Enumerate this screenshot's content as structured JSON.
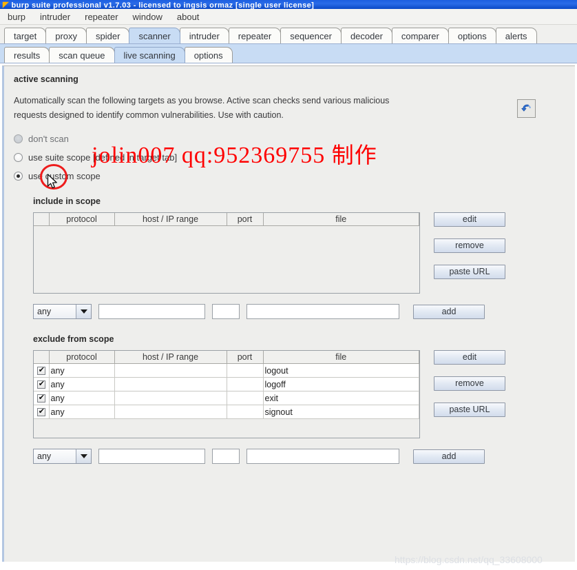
{
  "window": {
    "title": "burp suite professional v1.7.03 - licensed to ingsis ormaz [single user license]",
    "icon": "burp-logo-icon"
  },
  "menubar": {
    "items": [
      {
        "label": "burp"
      },
      {
        "label": "intruder"
      },
      {
        "label": "repeater"
      },
      {
        "label": "window"
      },
      {
        "label": "about"
      }
    ]
  },
  "main_tabs": {
    "items": [
      {
        "label": "target",
        "active": false
      },
      {
        "label": "proxy",
        "active": false
      },
      {
        "label": "spider",
        "active": false
      },
      {
        "label": "scanner",
        "active": true
      },
      {
        "label": "intruder",
        "active": false
      },
      {
        "label": "repeater",
        "active": false
      },
      {
        "label": "sequencer",
        "active": false
      },
      {
        "label": "decoder",
        "active": false
      },
      {
        "label": "comparer",
        "active": false
      },
      {
        "label": "options",
        "active": false
      },
      {
        "label": "alerts",
        "active": false
      }
    ]
  },
  "sub_tabs": {
    "items": [
      {
        "label": "results",
        "active": false
      },
      {
        "label": "scan queue",
        "active": false
      },
      {
        "label": "live scanning",
        "active": true
      },
      {
        "label": "options",
        "active": false
      }
    ]
  },
  "panel": {
    "heading": "active scanning",
    "description": "Automatically scan the following targets as you browse. Active scan checks send various malicious requests designed to identify common vulnerabilities. Use with caution.",
    "restore_icon": "undo-restore-icon"
  },
  "scan_mode": {
    "options": [
      {
        "label": "don't scan",
        "selected": false,
        "disabled": true
      },
      {
        "label": "use suite scope [defined in target tab]",
        "selected": false,
        "disabled": false
      },
      {
        "label": "use custom scope",
        "selected": true,
        "disabled": false
      }
    ]
  },
  "include_scope": {
    "title": "include in scope",
    "columns": [
      "",
      "protocol",
      "host / IP range",
      "port",
      "file"
    ],
    "rows": [],
    "buttons": [
      "edit",
      "remove",
      "paste URL"
    ],
    "add_row": {
      "protocol_value": "any",
      "host_value": "",
      "port_value": "",
      "file_value": "",
      "add_label": "add"
    }
  },
  "exclude_scope": {
    "title": "exclude from scope",
    "columns": [
      "",
      "protocol",
      "host / IP range",
      "port",
      "file"
    ],
    "rows": [
      {
        "checked": true,
        "protocol": "any",
        "host": "",
        "port": "",
        "file": "logout"
      },
      {
        "checked": true,
        "protocol": "any",
        "host": "",
        "port": "",
        "file": "logoff"
      },
      {
        "checked": true,
        "protocol": "any",
        "host": "",
        "port": "",
        "file": "exit"
      },
      {
        "checked": true,
        "protocol": "any",
        "host": "",
        "port": "",
        "file": "signout"
      }
    ],
    "buttons": [
      "edit",
      "remove",
      "paste URL"
    ],
    "add_row": {
      "protocol_value": "any",
      "host_value": "",
      "port_value": "",
      "file_value": "",
      "add_label": "add"
    }
  },
  "watermarks": {
    "overlay_latin": "jolin007 qq:952369755",
    "overlay_cjk": "制作",
    "overlay_color": "#fe0000",
    "footer": "https://blog.csdn.net/qq_33608000",
    "footer_color": "#dcdfe4"
  },
  "annotation": {
    "circle_color": "#ee1c1c",
    "cursor": "mouse-pointer"
  }
}
